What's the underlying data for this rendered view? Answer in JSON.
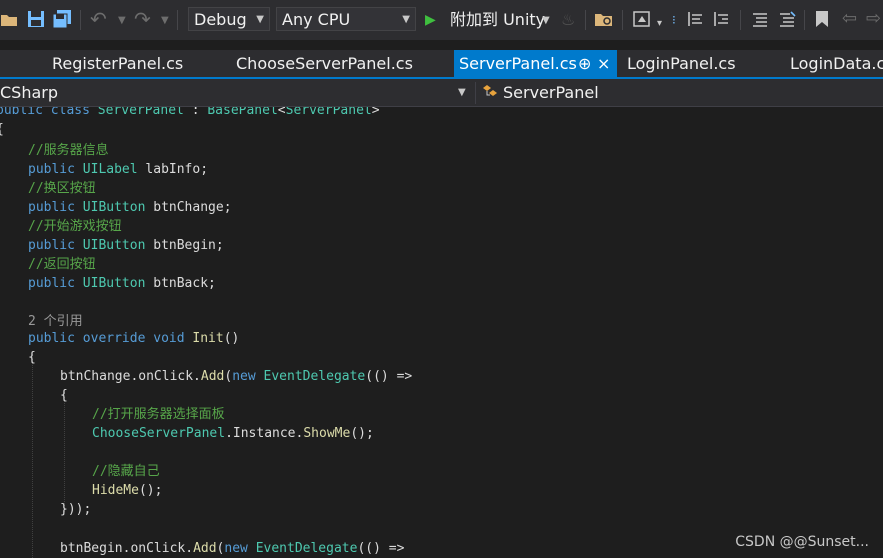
{
  "toolbar": {
    "config": "Debug",
    "platform": "Any CPU",
    "run_label": "附加到 Unity"
  },
  "tabs": [
    {
      "label": "RegisterPanel.cs"
    },
    {
      "label": "ChooseServerPanel.cs"
    },
    {
      "label": "ServerPanel.cs",
      "pin": "⊕",
      "close": "×"
    },
    {
      "label": "LoginPanel.cs"
    },
    {
      "label": "LoginData.cs"
    }
  ],
  "nav": {
    "project": "CSharp",
    "class_name": "ServerPanel"
  },
  "code": {
    "l0": {
      "t0": "public",
      "t1": "class",
      "t2": "ServerPanel",
      "t3": ":",
      "t4": "BasePanel",
      "t5": "<",
      "t6": "ServerPanel",
      "t7": ">"
    },
    "l1": {
      "t0": "{"
    },
    "l2": {
      "t0": "//服务器信息"
    },
    "l3": {
      "t0": "public",
      "t1": "UILabel",
      "t2": "labInfo;"
    },
    "l4": {
      "t0": "//换区按钮"
    },
    "l5": {
      "t0": "public",
      "t1": "UIButton",
      "t2": "btnChange;"
    },
    "l6": {
      "t0": "//开始游戏按钮"
    },
    "l7": {
      "t0": "public",
      "t1": "UIButton",
      "t2": "btnBegin;"
    },
    "l8": {
      "t0": "//返回按钮"
    },
    "l9": {
      "t0": "public",
      "t1": "UIButton",
      "t2": "btnBack;"
    },
    "l10": {
      "t0": "2 个引用"
    },
    "l11": {
      "t0": "public",
      "t1": "override",
      "t2": "void",
      "t3": "Init",
      "t4": "()"
    },
    "l12": {
      "t0": "{"
    },
    "l13": {
      "t0": "btnChange.onClick.",
      "t1": "Add",
      "t2": "(",
      "t3": "new",
      "t4": "EventDelegate",
      "t5": "(() =>"
    },
    "l14": {
      "t0": "{"
    },
    "l15": {
      "t0": "//打开服务器选择面板"
    },
    "l16": {
      "t0": "ChooseServerPanel",
      "t1": ".Instance.",
      "t2": "ShowMe",
      "t3": "();"
    },
    "l17": {
      "t0": "//隐藏自己"
    },
    "l18": {
      "t0": "HideMe",
      "t1": "();"
    },
    "l19": {
      "t0": "}));"
    },
    "l20": {
      "t0": "btnBegin.onClick.",
      "t1": "Add",
      "t2": "(",
      "t3": "new",
      "t4": "EventDelegate",
      "t5": "(() =>"
    }
  },
  "watermark": "CSDN @@Sunset..."
}
